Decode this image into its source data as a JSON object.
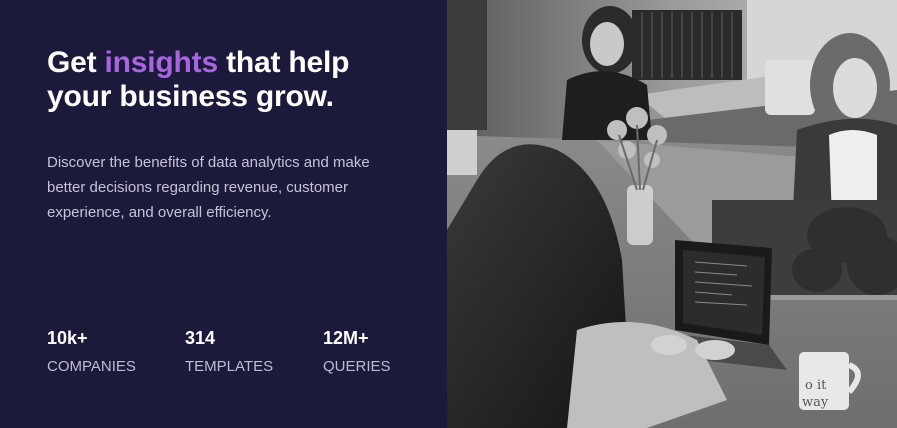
{
  "hero": {
    "headline_part1": "Get ",
    "headline_accent": "insights",
    "headline_part2": " that help",
    "headline_line2": "your business grow.",
    "description": "Discover the benefits of data analytics and make better decisions regarding revenue, customer experience, and overall efficiency.",
    "accent_color": "#a765e0",
    "background_color": "#1c1a3b"
  },
  "stats": [
    {
      "value": "10k+",
      "label": "COMPANIES"
    },
    {
      "value": "314",
      "label": "TEMPLATES"
    },
    {
      "value": "12M+",
      "label": "QUERIES"
    }
  ],
  "photo": {
    "mug_text_line1": "o it",
    "mug_text_line2": "way"
  }
}
